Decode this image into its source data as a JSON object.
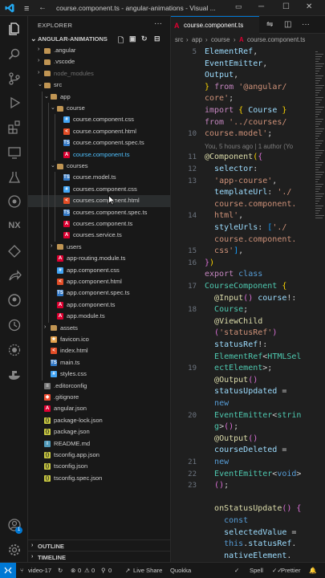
{
  "window": {
    "title": "course.component.ts - angular-animations - Visual ...",
    "menu_icon": "hamburger-menu-icon",
    "back_icon": "arrow-left-icon",
    "forward_icon": "arrow-right-icon",
    "controls": [
      "minimize",
      "maximize",
      "close"
    ]
  },
  "activity_bar": {
    "items": [
      "explorer-icon",
      "search-icon",
      "source-control-icon",
      "run-debug-icon",
      "extensions-icon",
      "remote-explorer-icon",
      "testing-icon",
      "docker-icon",
      "nx-icon",
      "git-graph-icon",
      "live-share-icon",
      "github-icon",
      "timeline-icon",
      "settings-sync-icon",
      "kubernetes-icon"
    ],
    "nx_label": "NX",
    "accounts_icon": "account-icon",
    "manage_icon": "gear-icon",
    "accounts_badge": "1"
  },
  "sidebar": {
    "title": "EXPLORER",
    "more_icon": "ellipsis-icon",
    "project": "ANGULAR-ANIMATIONS",
    "project_actions": [
      "new-file-icon",
      "new-folder-icon",
      "refresh-icon",
      "collapse-all-icon"
    ],
    "tree": [
      {
        "label": ".angular",
        "depth": 1,
        "type": "folder",
        "open": false
      },
      {
        "label": ".vscode",
        "depth": 1,
        "type": "folder",
        "open": false
      },
      {
        "label": "node_modules",
        "depth": 1,
        "type": "folder",
        "open": false,
        "dim": true
      },
      {
        "label": "src",
        "depth": 1,
        "type": "folder",
        "open": true
      },
      {
        "label": "app",
        "depth": 2,
        "type": "folder",
        "open": true
      },
      {
        "label": "course",
        "depth": 3,
        "type": "folder",
        "open": true
      },
      {
        "label": "course.component.css",
        "depth": 4,
        "type": "css"
      },
      {
        "label": "course.component.html",
        "depth": 4,
        "type": "html"
      },
      {
        "label": "course.component.spec.ts",
        "depth": 4,
        "type": "spec"
      },
      {
        "label": "course.component.ts",
        "depth": 4,
        "type": "ng",
        "active": true
      },
      {
        "label": "courses",
        "depth": 3,
        "type": "folder",
        "open": true
      },
      {
        "label": "course.model.ts",
        "depth": 4,
        "type": "ts"
      },
      {
        "label": "courses.component.css",
        "depth": 4,
        "type": "css"
      },
      {
        "label": "courses.component.html",
        "depth": 4,
        "type": "html",
        "selected": true
      },
      {
        "label": "courses.component.spec.ts",
        "depth": 4,
        "type": "spec"
      },
      {
        "label": "courses.component.ts",
        "depth": 4,
        "type": "ng"
      },
      {
        "label": "courses.service.ts",
        "depth": 4,
        "type": "ng"
      },
      {
        "label": "users",
        "depth": 3,
        "type": "folder",
        "open": false
      },
      {
        "label": "app-routing.module.ts",
        "depth": 3,
        "type": "ng"
      },
      {
        "label": "app.component.css",
        "depth": 3,
        "type": "css"
      },
      {
        "label": "app.component.html",
        "depth": 3,
        "type": "html"
      },
      {
        "label": "app.component.spec.ts",
        "depth": 3,
        "type": "spec"
      },
      {
        "label": "app.component.ts",
        "depth": 3,
        "type": "ng"
      },
      {
        "label": "app.module.ts",
        "depth": 3,
        "type": "ng"
      },
      {
        "label": "assets",
        "depth": 2,
        "type": "folder",
        "open": false
      },
      {
        "label": "favicon.ico",
        "depth": 2,
        "type": "ico"
      },
      {
        "label": "index.html",
        "depth": 2,
        "type": "html"
      },
      {
        "label": "main.ts",
        "depth": 2,
        "type": "ts"
      },
      {
        "label": "styles.css",
        "depth": 2,
        "type": "css"
      },
      {
        "label": ".editorconfig",
        "depth": 1,
        "type": "config"
      },
      {
        "label": ".gitignore",
        "depth": 1,
        "type": "git"
      },
      {
        "label": "angular.json",
        "depth": 1,
        "type": "ng"
      },
      {
        "label": "package-lock.json",
        "depth": 1,
        "type": "json"
      },
      {
        "label": "package.json",
        "depth": 1,
        "type": "json"
      },
      {
        "label": "README.md",
        "depth": 1,
        "type": "md"
      },
      {
        "label": "tsconfig.app.json",
        "depth": 1,
        "type": "json"
      },
      {
        "label": "tsconfig.json",
        "depth": 1,
        "type": "json"
      },
      {
        "label": "tsconfig.spec.json",
        "depth": 1,
        "type": "json"
      }
    ],
    "outline_label": "OUTLINE",
    "timeline_label": "TIMELINE"
  },
  "editor": {
    "tab_icon_letter": "A",
    "tab_label": "course.component.ts",
    "tab_actions": [
      "compare-icon",
      "more-actions-icon"
    ],
    "breadcrumb": [
      "src",
      "app",
      "course",
      "course.component.ts"
    ],
    "blame": "You, 5 hours ago | 1 author (Yo",
    "line_numbers": [
      "5",
      "",
      "",
      "",
      "",
      "",
      "",
      "10",
      "",
      "11",
      "12",
      "13",
      "",
      "",
      "14",
      "",
      "",
      "15",
      "16",
      "",
      "17",
      "",
      "18",
      "",
      "",
      "",
      "",
      "19",
      "",
      "",
      "",
      "20",
      "",
      "",
      "",
      "21",
      "22",
      "23",
      "",
      ""
    ],
    "lines": [
      [
        [
          "v",
          "ElementRef"
        ],
        [
          "p",
          ","
        ]
      ],
      [
        [
          "v",
          "EventEmitter"
        ],
        [
          "p",
          ","
        ]
      ],
      [
        [
          "v",
          "Output"
        ],
        [
          "p",
          ","
        ]
      ],
      [
        [
          "b1",
          "}"
        ],
        [
          "p",
          " "
        ],
        [
          "kw",
          "from"
        ],
        [
          "p",
          " "
        ],
        [
          "s",
          "'@angular/"
        ]
      ],
      [
        [
          "s",
          "core'"
        ],
        [
          "p",
          ";"
        ]
      ],
      [
        [
          "kw",
          "import"
        ],
        [
          "p",
          " "
        ],
        [
          "b1",
          "{"
        ],
        [
          "p",
          " "
        ],
        [
          "v",
          "Course"
        ],
        [
          "p",
          " "
        ],
        [
          "b1",
          "}"
        ]
      ],
      [
        [
          "kw",
          "from"
        ],
        [
          "p",
          " "
        ],
        [
          "s",
          "'../courses/"
        ]
      ],
      [
        [
          "s",
          "course.model'"
        ],
        [
          "p",
          ";"
        ]
      ],
      [
        [
          "blame",
          ""
        ]
      ],
      [
        [
          "d",
          "@Component"
        ],
        [
          "b1",
          "("
        ],
        [
          "b2",
          "{"
        ]
      ],
      [
        [
          "p",
          "  "
        ],
        [
          "v",
          "selector"
        ],
        [
          "p",
          ":"
        ]
      ],
      [
        [
          "p",
          "  "
        ],
        [
          "s",
          "'app-course'"
        ],
        [
          "p",
          ","
        ]
      ],
      [
        [
          "p",
          "  "
        ],
        [
          "v",
          "templateUrl"
        ],
        [
          "p",
          ": "
        ],
        [
          "s",
          "'./"
        ]
      ],
      [
        [
          "p",
          "  "
        ],
        [
          "s",
          "course.component."
        ]
      ],
      [
        [
          "p",
          "  "
        ],
        [
          "s",
          "html'"
        ],
        [
          "p",
          ","
        ]
      ],
      [
        [
          "p",
          "  "
        ],
        [
          "v",
          "styleUrls"
        ],
        [
          "p",
          ": "
        ],
        [
          "b3",
          "["
        ],
        [
          "s",
          "'./"
        ]
      ],
      [
        [
          "p",
          "  "
        ],
        [
          "s",
          "course.component."
        ]
      ],
      [
        [
          "p",
          "  "
        ],
        [
          "s",
          "css'"
        ],
        [
          "b3",
          "]"
        ],
        [
          "p",
          ","
        ]
      ],
      [
        [
          "b2",
          "}"
        ],
        [
          "b1",
          ")"
        ]
      ],
      [
        [
          "kw",
          "export"
        ],
        [
          "p",
          " "
        ],
        [
          "k",
          "class"
        ]
      ],
      [
        [
          "ty",
          "CourseComponent"
        ],
        [
          "p",
          " "
        ],
        [
          "b1",
          "{"
        ]
      ],
      [
        [
          "p",
          "  "
        ],
        [
          "d",
          "@Input"
        ],
        [
          "b2",
          "()"
        ],
        [
          "p",
          " "
        ],
        [
          "v",
          "course"
        ],
        [
          "p",
          "!:"
        ]
      ],
      [
        [
          "p",
          "  "
        ],
        [
          "ty",
          "Course"
        ],
        [
          "p",
          ";"
        ]
      ],
      [
        [
          "p",
          "  "
        ],
        [
          "d",
          "@ViewChild"
        ]
      ],
      [
        [
          "p",
          "  "
        ],
        [
          "b2",
          "("
        ],
        [
          "s",
          "'statusRef'"
        ],
        [
          "b2",
          ")"
        ]
      ],
      [
        [
          "p",
          "  "
        ],
        [
          "v",
          "statusRef"
        ],
        [
          "p",
          "!:"
        ]
      ],
      [
        [
          "p",
          "  "
        ],
        [
          "ty",
          "ElementRef"
        ],
        [
          "p",
          "<"
        ],
        [
          "ty",
          "HTMLSel"
        ]
      ],
      [
        [
          "p",
          "  "
        ],
        [
          "ty",
          "ectElement"
        ],
        [
          "p",
          ">;"
        ]
      ],
      [
        [
          "p",
          "  "
        ],
        [
          "d",
          "@Output"
        ],
        [
          "b2",
          "()"
        ]
      ],
      [
        [
          "p",
          "  "
        ],
        [
          "v",
          "statusUpdated"
        ],
        [
          "p",
          " ="
        ]
      ],
      [
        [
          "p",
          "  "
        ],
        [
          "k",
          "new"
        ]
      ],
      [
        [
          "p",
          "  "
        ],
        [
          "ty",
          "EventEmitter"
        ],
        [
          "p",
          "<"
        ],
        [
          "ty",
          "strin"
        ]
      ],
      [
        [
          "p",
          "  "
        ],
        [
          "ty",
          "g"
        ],
        [
          "p",
          ">"
        ],
        [
          "b2",
          "()"
        ],
        [
          "p",
          ";"
        ]
      ],
      [
        [
          "p",
          "  "
        ],
        [
          "d",
          "@Output"
        ],
        [
          "b2",
          "()"
        ]
      ],
      [
        [
          "p",
          "  "
        ],
        [
          "v",
          "courseDeleted"
        ],
        [
          "p",
          " ="
        ]
      ],
      [
        [
          "p",
          "  "
        ],
        [
          "k",
          "new"
        ]
      ],
      [
        [
          "p",
          "  "
        ],
        [
          "ty",
          "EventEmitter"
        ],
        [
          "p",
          "<"
        ],
        [
          "k",
          "void"
        ],
        [
          "p",
          ">"
        ]
      ],
      [
        [
          "p",
          "  "
        ],
        [
          "b2",
          "()"
        ],
        [
          "p",
          ";"
        ]
      ],
      [
        [
          "p",
          ""
        ]
      ],
      [
        [
          "p",
          "  "
        ],
        [
          "fn",
          "onStatusUpdate"
        ],
        [
          "b2",
          "()"
        ],
        [
          "p",
          " "
        ],
        [
          "b2",
          "{"
        ]
      ],
      [
        [
          "p",
          "    "
        ],
        [
          "k",
          "const"
        ]
      ],
      [
        [
          "p",
          "    "
        ],
        [
          "v",
          "selectedValue"
        ],
        [
          "p",
          " ="
        ]
      ],
      [
        [
          "p",
          "    "
        ],
        [
          "k",
          "this"
        ],
        [
          "p",
          "."
        ],
        [
          "v",
          "statusRef"
        ],
        [
          "p",
          "."
        ]
      ],
      [
        [
          "p",
          "    "
        ],
        [
          "v",
          "nativeElement"
        ],
        [
          "p",
          "."
        ]
      ]
    ]
  },
  "status_bar": {
    "remote_icon": "remote-icon",
    "branch": "video-17",
    "sync": "0",
    "errors": "0",
    "warnings": "0",
    "ports": "0",
    "live_share": "Live Share",
    "quokka": "Quokka",
    "spell": "Spell",
    "prettier": "Prettier"
  },
  "colors": {
    "accent": "#0078d4",
    "angular": "#dd0031",
    "css": "#42a5f5",
    "html": "#e44d26",
    "ts": "#3178c6"
  }
}
